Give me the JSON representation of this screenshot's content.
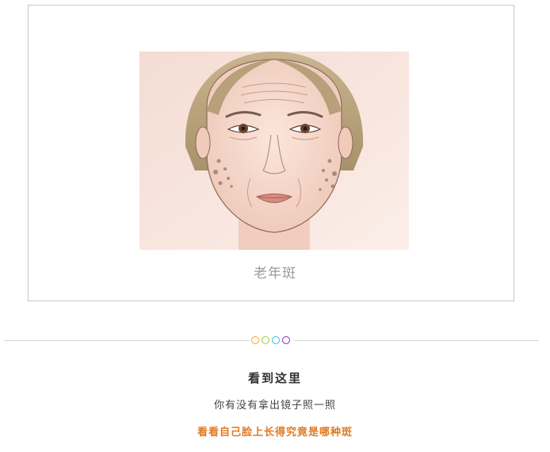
{
  "figure": {
    "caption": "老年斑"
  },
  "divider": {
    "dot_colors": [
      "#f5a623",
      "#9acd32",
      "#3ab8e8",
      "#8e24c7"
    ]
  },
  "text": {
    "heading": "看到这里",
    "subtext": "你有没有拿出镜子照一照",
    "highlight": "看看自己脸上长得究竟是哪种斑"
  },
  "colors": {
    "highlight": "#e07a22",
    "frame_border": "#c9c4cf"
  }
}
